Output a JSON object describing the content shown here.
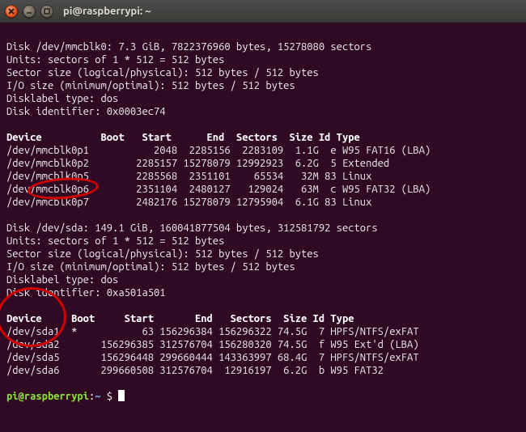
{
  "window": {
    "title": "pi@raspberrypi: ~"
  },
  "disks": [
    {
      "header1": "Disk /dev/mmcblk0: 7.3 GiB, 7822376960 bytes, 15278080 sectors",
      "header2": "Units: sectors of 1 * 512 = 512 bytes",
      "header3": "Sector size (logical/physical): 512 bytes / 512 bytes",
      "header4": "I/O size (minimum/optimal): 512 bytes / 512 bytes",
      "header5": "Disklabel type: dos",
      "header6": "Disk identifier: 0x0003ec74"
    },
    {
      "header1": "Disk /dev/sda: 149.1 GiB, 160041877504 bytes, 312581792 sectors",
      "header2": "Units: sectors of 1 * 512 = 512 bytes",
      "header3": "Sector size (logical/physical): 512 bytes / 512 bytes",
      "header4": "I/O size (minimum/optimal): 512 bytes / 512 bytes",
      "header5": "Disklabel type: dos",
      "header6": "Disk identifier: 0xa501a501"
    }
  ],
  "tableHeader1": "Device          Boot   Start      End  Sectors  Size Id Type",
  "partitions1": {
    "r0": "/dev/mmcblk0p1           2048  2285156  2283109  1.1G  e W95 FAT16 (LBA)",
    "r1": "/dev/mmcblk0p2        2285157 15278079 12992923  6.2G  5 Extended",
    "r2": "/dev/mmcblk0p5        2285568  2351101    65534   32M 83 Linux",
    "r3": "/dev/mmcblk0p6        2351104  2480127   129024   63M  c W95 FAT32 (LBA)",
    "r4": "/dev/mmcblk0p7        2482176 15278079 12795904  6.1G 83 Linux"
  },
  "tableHeader2": "Device     Boot     Start       End   Sectors  Size Id Type",
  "partitions2": {
    "r0": "/dev/sda1  *           63 156296384 156296322 74.5G  7 HPFS/NTFS/exFAT",
    "r1": "/dev/sda2       156296385 312576704 156280320 74.5G  f W95 Ext'd (LBA)",
    "r2": "/dev/sda5       156296448 299660444 143363997 68.4G  7 HPFS/NTFS/exFAT",
    "r3": "/dev/sda6       299660508 312576704  12916197  6.2G  b W95 FAT32"
  },
  "prompt": {
    "userhost": "pi@raspberrypi",
    "colon": ":",
    "path": "~",
    "symbol": " $ "
  }
}
